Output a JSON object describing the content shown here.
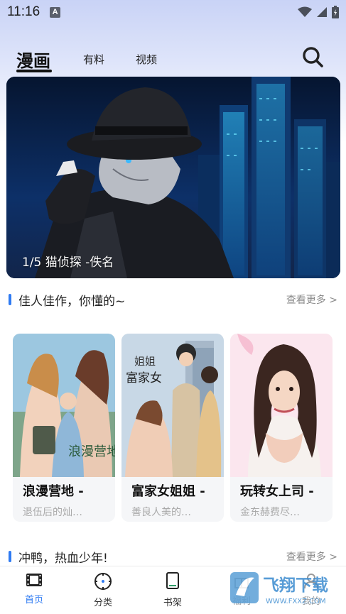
{
  "status_bar": {
    "time": "11:16",
    "notification_badge": "A"
  },
  "header": {
    "tabs": [
      {
        "label": "漫画",
        "active": true
      },
      {
        "label": "有料",
        "active": false
      },
      {
        "label": "视频",
        "active": false
      }
    ]
  },
  "banner": {
    "caption": "1/5 猫侦探 -佚名"
  },
  "section1": {
    "title": "佳人佳作，你懂的~",
    "more": "查看更多 >"
  },
  "cards": [
    {
      "title": "浪漫营地 -",
      "subtitle": "退伍后的灿…",
      "cover_text": "浪漫营地"
    },
    {
      "title": "富家女姐姐 -",
      "subtitle": "善良人美的…",
      "cover_text_1": "姐姐",
      "cover_text_2": "富家女"
    },
    {
      "title": "玩转女上司 -",
      "subtitle": "金东赫费尽…"
    }
  ],
  "section2": {
    "title": "冲鸭，热血少年!",
    "more": "查看更多 >"
  },
  "bottom_nav": [
    {
      "label": "首页",
      "icon": "film-icon",
      "active": true
    },
    {
      "label": "分类",
      "icon": "compass-icon",
      "active": false
    },
    {
      "label": "书架",
      "icon": "bookshelf-icon",
      "active": false
    },
    {
      "label": "福利",
      "icon": "gift-icon",
      "active": false
    },
    {
      "label": "我的",
      "icon": "user-icon",
      "active": false
    }
  ],
  "watermark": {
    "text": "飞翔下载",
    "domain": "WWW.FXXZ.COM"
  },
  "colors": {
    "accent": "#2f7bf2",
    "header_bg": "#c9d3f6"
  }
}
